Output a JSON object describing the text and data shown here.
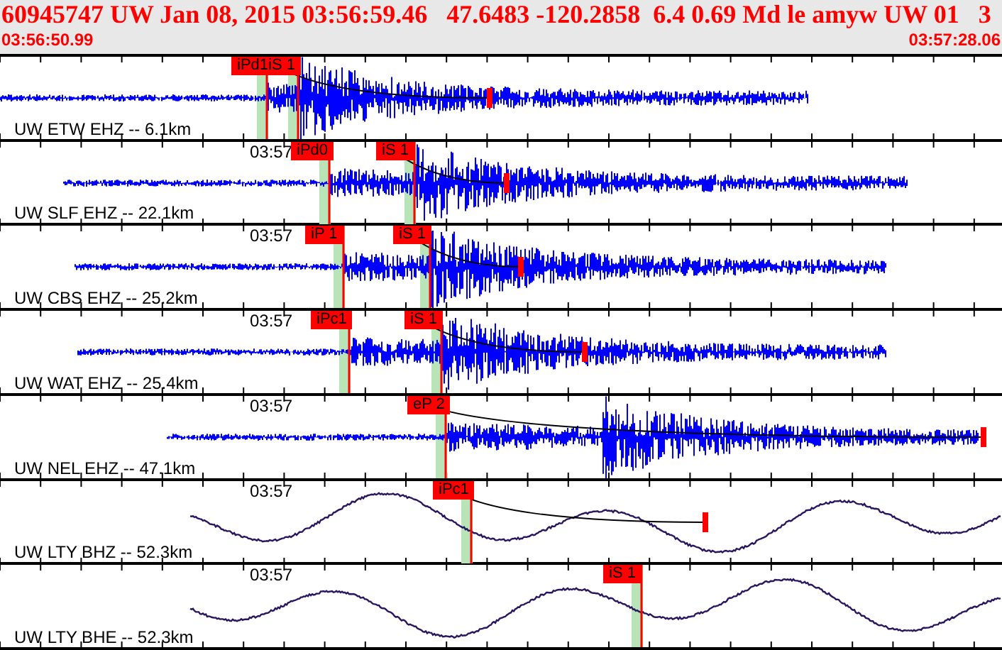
{
  "header": {
    "title": "60945747 UW Jan 08, 2015 03:56:59.46   47.6483 -120.2858  6.4 0.69 Md le amyw UW 01   3",
    "start_time": "03:56:50.99",
    "end_time": "03:57:28.06"
  },
  "traces": [
    {
      "kind": "short_period",
      "label": "UW ETW EHZ -- 6.1km",
      "picks": [
        "iPd1iS 1"
      ]
    },
    {
      "kind": "short_period",
      "label": "UW SLF EHZ -- 22.1km",
      "time_mark": "03:57",
      "picks": [
        "iPd0",
        "iS 1"
      ]
    },
    {
      "kind": "short_period",
      "label": "UW CBS EHZ -- 25.2km",
      "time_mark": "03:57",
      "picks": [
        "iP 1",
        "iS 1"
      ]
    },
    {
      "kind": "short_period",
      "label": "UW WAT EHZ -- 25.4km",
      "time_mark": "03:57",
      "picks": [
        "iPc1",
        "iS 1"
      ]
    },
    {
      "kind": "short_period",
      "label": "UW NEL EHZ -- 47.1km",
      "time_mark": "03:57",
      "picks": [
        "eP 2"
      ]
    },
    {
      "kind": "broadband",
      "label": "UW LTY BHZ -- 52.3km",
      "time_mark": "03:57",
      "picks": [
        "iPc1"
      ]
    },
    {
      "kind": "broadband",
      "label": "UW LTY BHE -- 52.3km",
      "time_mark": "03:57",
      "picks": [
        "iS 1"
      ]
    }
  ]
}
